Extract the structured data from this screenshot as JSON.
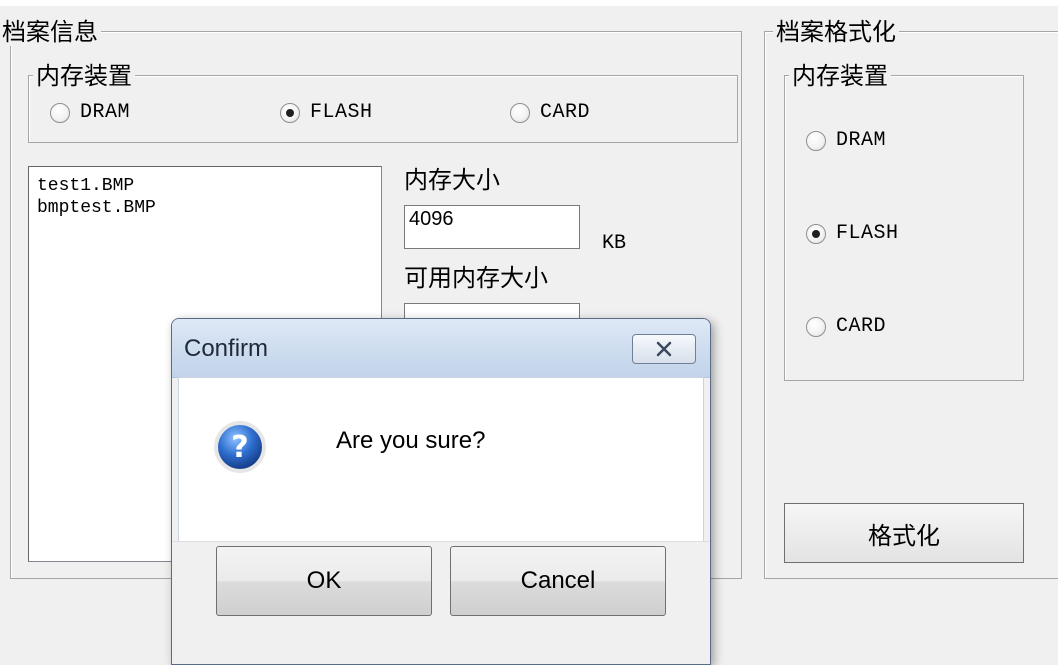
{
  "file_info": {
    "title": "档案信息",
    "memory_device": {
      "title": "内存装置",
      "options": [
        "DRAM",
        "FLASH",
        "CARD"
      ],
      "selected": "FLASH"
    },
    "files": [
      "test1.BMP",
      "bmptest.BMP"
    ],
    "memory_size_label": "内存大小",
    "memory_size_value": "4096",
    "memory_size_unit": "KB",
    "free_memory_label": "可用内存大小"
  },
  "format_panel": {
    "title": "档案格式化",
    "memory_device": {
      "title": "内存装置",
      "options": [
        "DRAM",
        "FLASH",
        "CARD"
      ],
      "selected": "FLASH"
    },
    "format_button": "格式化"
  },
  "dialog": {
    "title": "Confirm",
    "message": "Are you sure?",
    "ok": "OK",
    "cancel": "Cancel",
    "icon": "question-icon"
  }
}
